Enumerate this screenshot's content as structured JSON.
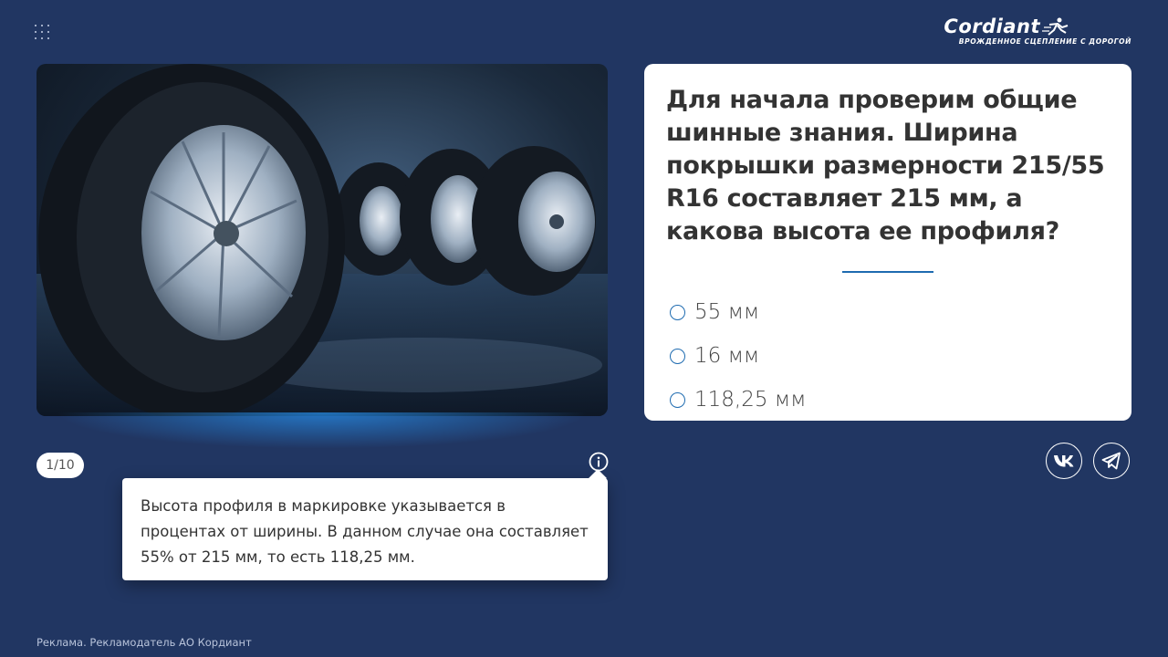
{
  "header": {
    "menu_icon": "grid-icon",
    "logo": {
      "wordmark": "Cordiant",
      "tagline": "ВРОЖДЕННОЕ СЦЕПЛЕНИЕ С ДОРОГОЙ"
    }
  },
  "photo": {
    "icon": "tires-image"
  },
  "quiz": {
    "question": "Для начала проверим общие шинные знания. Ширина покрышки размерности 215/55 R16 составляет 215 мм, а какова высота ее профиля?",
    "answers": [
      {
        "label": "55 мм"
      },
      {
        "label": "16 мм"
      },
      {
        "label": "118,25 мм"
      }
    ],
    "progress": "1/10"
  },
  "tooltip": {
    "text": "Высота профиля в маркировке указывается в процентах от ширины. В данном случае она составляет 55% от 215 мм, то есть 118,25 мм."
  },
  "social": {
    "vk_icon": "vk-icon",
    "telegram_icon": "telegram-icon"
  },
  "footer": {
    "disclaimer": "Реклама. Рекламодатель АО Кордиант"
  },
  "colors": {
    "background": "#213662",
    "accent": "#1e6bb0",
    "card": "#ffffff"
  }
}
